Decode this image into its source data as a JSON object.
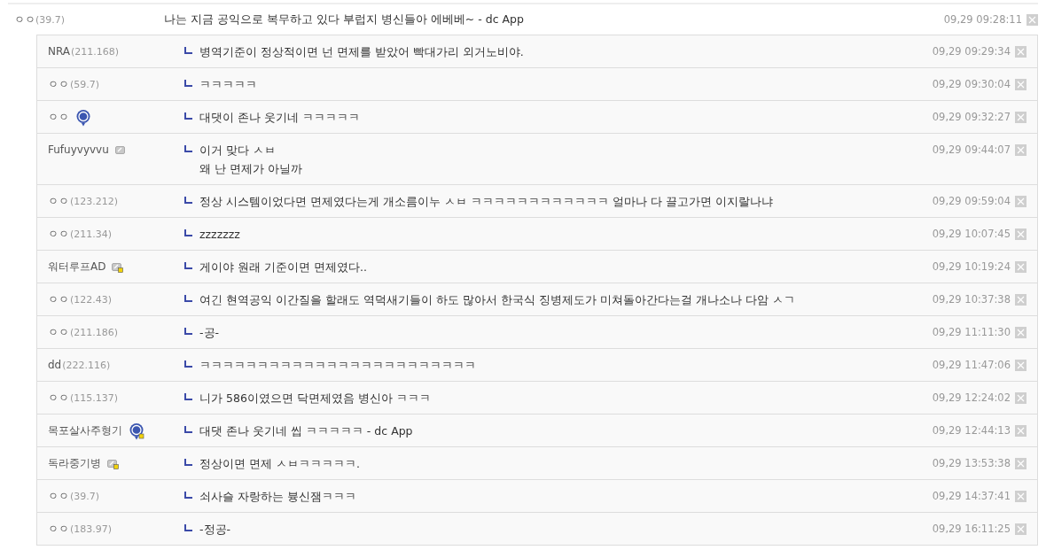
{
  "post": {
    "name": "ㅇㅇ",
    "ip": "(39.7)",
    "text": "나는 지금 공익으로 복무하고 있다 부럽지 병신들아 에베베~ - dc App",
    "time": "09,29 09:28:11"
  },
  "replies": [
    {
      "name": "NRA",
      "ip": "(211.168)",
      "lines": [
        "병역기준이 정상적이면 넌 면제를 받았어 빡대가리 외거노비야."
      ],
      "time": "09,29 09:29:34"
    },
    {
      "name": "ㅇㅇ",
      "ip": "(59.7)",
      "lines": [
        "ㅋㅋㅋㅋㅋ"
      ],
      "time": "09,29 09:30:04"
    },
    {
      "name": "ㅇㅇ",
      "badge": {
        "kind": "app"
      },
      "lines": [
        "대댓이 존나 웃기네 ㅋㅋㅋㅋㅋ"
      ],
      "time": "09,29 09:32:27"
    },
    {
      "name": "Fufuyvyvvu",
      "badge": {
        "kind": "fixed"
      },
      "lines": [
        "이거 맞다 ㅅㅂ",
        "왜 난 면제가 아닐까"
      ],
      "time": "09,29 09:44:07"
    },
    {
      "name": "ㅇㅇ",
      "ip": "(123.212)",
      "lines": [
        "정상 시스템이었다면 면제였다는게 개소름이누 ㅅㅂ ㅋㅋㅋㅋㅋㅋㅋㅋㅋㅋㅋㅋ 얼마나 다 끌고가면 이지랄나냐"
      ],
      "time": "09,29 09:59:04"
    },
    {
      "name": "ㅇㅇ",
      "ip": "(211.34)",
      "lines": [
        "zzzzzzz"
      ],
      "time": "09,29 10:07:45"
    },
    {
      "name": "워터루프AD",
      "badge": {
        "kind": "half"
      },
      "lines": [
        "게이야 원래 기준이면 면제였다.."
      ],
      "time": "09,29 10:19:24"
    },
    {
      "name": "ㅇㅇ",
      "ip": "(122.43)",
      "lines": [
        "여긴 현역공익 이간질을 할래도 역덕새기들이 하도 많아서 한국식 징병제도가 미쳐돌아간다는걸 개나소나 다암 ㅅㄱ"
      ],
      "time": "09,29 10:37:38"
    },
    {
      "name": "ㅇㅇ",
      "ip": "(211.186)",
      "lines": [
        "-공-"
      ],
      "time": "09,29 11:11:30"
    },
    {
      "name": "dd",
      "ip": "(222.116)",
      "lines": [
        "ㅋㅋㅋㅋㅋㅋㅋㅋㅋㅋㅋㅋㅋㅋㅋㅋㅋㅋㅋㅋㅋㅋㅋㅋ"
      ],
      "time": "09,29 11:47:06"
    },
    {
      "name": "ㅇㅇ",
      "ip": "(115.137)",
      "lines": [
        "니가 586이였으면 닥면제였음 병신아 ㅋㅋㅋ"
      ],
      "time": "09,29 12:24:02"
    },
    {
      "name": "목포살사주형기",
      "badge": {
        "kind": "app-half"
      },
      "lines": [
        "대댓 존나 웃기네 씹 ㅋㅋㅋㅋㅋ - dc App"
      ],
      "time": "09,29 12:44:13"
    },
    {
      "name": "독라중기병",
      "badge": {
        "kind": "half"
      },
      "lines": [
        "정상이면 면제 ㅅㅂㅋㅋㅋㅋㅋ."
      ],
      "time": "09,29 13:53:38"
    },
    {
      "name": "ㅇㅇ",
      "ip": "(39.7)",
      "lines": [
        "쇠사슬 자랑하는 븅신잼ㅋㅋㅋ"
      ],
      "time": "09,29 14:37:41"
    },
    {
      "name": "ㅇㅇ",
      "ip": "(183.97)",
      "lines": [
        "-정공-"
      ],
      "time": "09,29 16:11:25"
    }
  ]
}
